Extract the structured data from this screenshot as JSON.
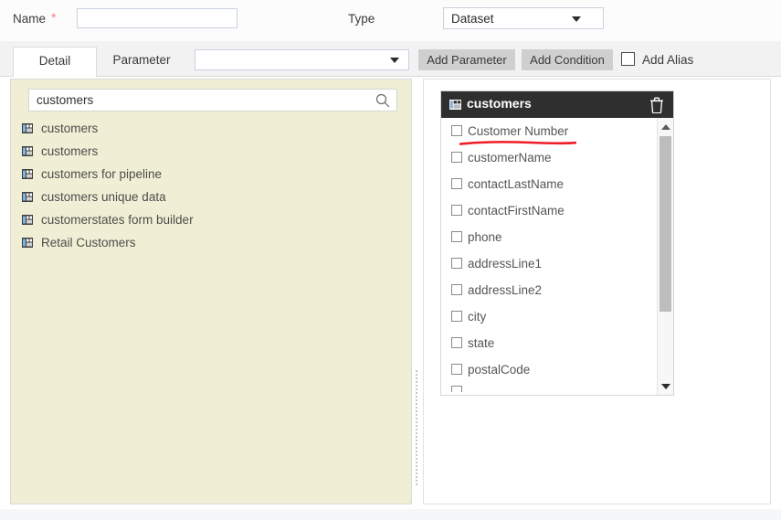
{
  "form": {
    "name_label": "Name",
    "required_marker": "*",
    "name_value": "",
    "name_placeholder": "",
    "type_label": "Type",
    "type_value": "Dataset"
  },
  "tabs": [
    {
      "label": "Detail",
      "active": true
    },
    {
      "label": "Parameter",
      "active": false
    }
  ],
  "toolbar": {
    "param_select_value": "",
    "add_parameter_label": "Add Parameter",
    "add_condition_label": "Add Condition",
    "add_alias_label": "Add Alias",
    "add_alias_checked": false
  },
  "left_panel": {
    "search_value": "customers",
    "search_placeholder": "",
    "search_icon": "search-icon",
    "items": [
      {
        "label": "customers",
        "icon": "table-icon"
      },
      {
        "label": "customers",
        "icon": "table-icon"
      },
      {
        "label": "customers for pipeline",
        "icon": "table-icon"
      },
      {
        "label": "customers unique data",
        "icon": "table-icon"
      },
      {
        "label": "customerstates form builder",
        "icon": "table-icon"
      },
      {
        "label": "Retail Customers",
        "icon": "table-icon"
      }
    ]
  },
  "right_panel": {
    "card": {
      "title": "customers",
      "title_icon": "table-icon",
      "delete_icon": "trash-icon",
      "fields": [
        {
          "label": "Customer Number",
          "checked": false,
          "annotated": true
        },
        {
          "label": "customerName",
          "checked": false
        },
        {
          "label": "contactLastName",
          "checked": false
        },
        {
          "label": "contactFirstName",
          "checked": false
        },
        {
          "label": "phone",
          "checked": false
        },
        {
          "label": "addressLine1",
          "checked": false
        },
        {
          "label": "addressLine2",
          "checked": false
        },
        {
          "label": "city",
          "checked": false
        },
        {
          "label": "state",
          "checked": false
        },
        {
          "label": "postalCode",
          "checked": false
        }
      ],
      "scrollbar": {
        "up_icon": "caret-up-icon",
        "down_icon": "caret-down-icon"
      }
    }
  },
  "colors": {
    "left_panel_bg": "#f0efd5",
    "card_header_bg": "#2f2f2f",
    "annotation_red": "#ee1c25",
    "button_bg": "#cfcfcf",
    "required_star": "#f08080"
  }
}
